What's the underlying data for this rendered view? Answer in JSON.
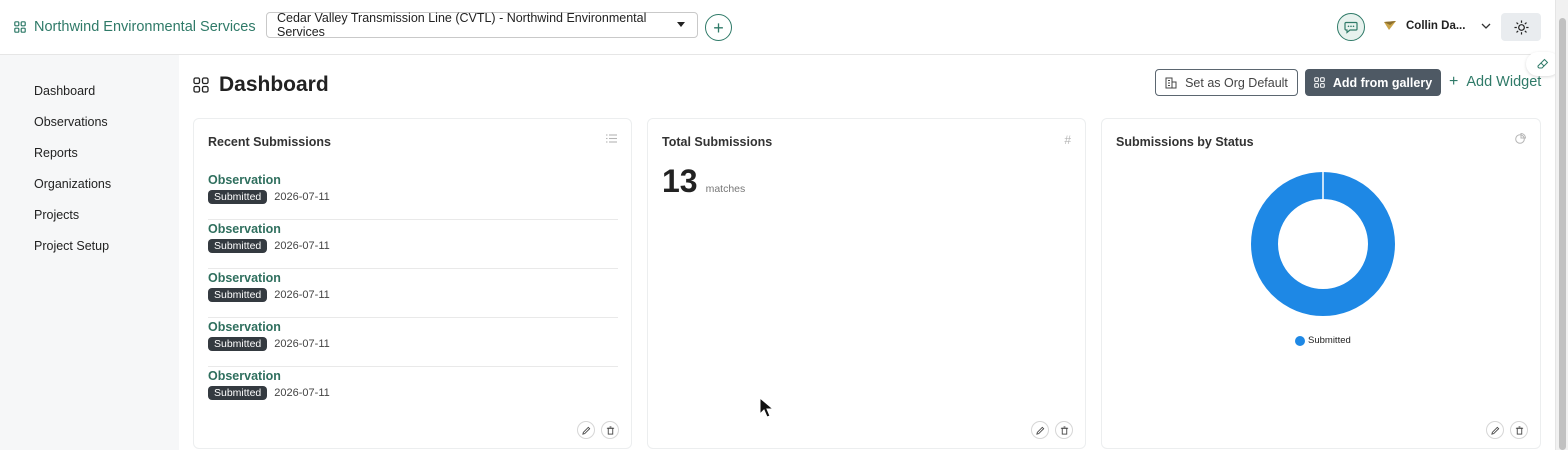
{
  "header": {
    "brand": "Northwind Environmental Services",
    "project_selected": "Cedar Valley Transmission Line (CVTL) - Northwind Environmental Services",
    "add_project_label": "+",
    "user_name": "Collin Da..."
  },
  "sidebar": {
    "items": [
      {
        "label": "Dashboard"
      },
      {
        "label": "Observations"
      },
      {
        "label": "Reports"
      },
      {
        "label": "Organizations"
      },
      {
        "label": "Projects"
      },
      {
        "label": "Project Setup"
      }
    ]
  },
  "main": {
    "title": "Dashboard",
    "actions": {
      "set_default": "Set as Org Default",
      "add_gallery": "Add from gallery",
      "add_widget": "Add Widget"
    }
  },
  "widgets": {
    "recent": {
      "title": "Recent Submissions",
      "items": [
        {
          "title": "Observation",
          "status": "Submitted",
          "date": "2026-07-11"
        },
        {
          "title": "Observation",
          "status": "Submitted",
          "date": "2026-07-11"
        },
        {
          "title": "Observation",
          "status": "Submitted",
          "date": "2026-07-11"
        },
        {
          "title": "Observation",
          "status": "Submitted",
          "date": "2026-07-11"
        },
        {
          "title": "Observation",
          "status": "Submitted",
          "date": "2026-07-11"
        }
      ]
    },
    "total": {
      "title": "Total Submissions",
      "head_icon": "#",
      "count": "13",
      "unit": "matches"
    },
    "status": {
      "title": "Submissions by Status",
      "legend_label": "Submitted",
      "slices": [
        {
          "label": "Submitted",
          "value": 13,
          "color": "#1e88e5"
        }
      ]
    }
  },
  "colors": {
    "brand": "#2f7a68",
    "badge": "#343a40",
    "donut": "#1e88e5"
  },
  "icons": [
    "grid-icon",
    "chat-icon",
    "chevron-down-icon",
    "sun-icon",
    "building-icon",
    "list-icon",
    "hash-icon",
    "pie-icon",
    "edit-icon",
    "trash-icon",
    "plus-icon"
  ]
}
